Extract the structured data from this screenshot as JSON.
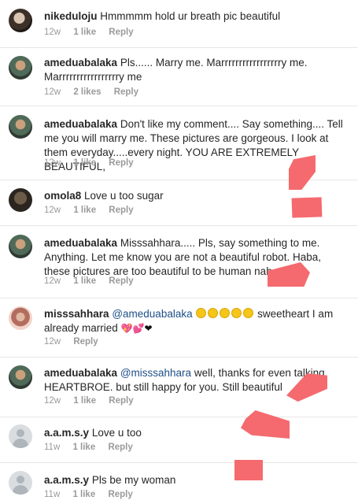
{
  "comments": [
    {
      "username": "nikeduloju",
      "text": "Hmmmmm hold ur breath pic beautiful",
      "time": "12w",
      "likes": "1 like",
      "reply": "Reply"
    },
    {
      "username": "ameduabalaka",
      "text": "Pls...... Marry me. Marrrrrrrrrrrrrrrrry me. Marrrrrrrrrrrrrrrrry me",
      "time": "12w",
      "likes": "2 likes",
      "reply": "Reply"
    },
    {
      "username": "ameduabalaka",
      "text": "Don't like my comment.... Say something.... Tell me you will marry me. These pictures are gorgeous. I look at them everyday.....every night. YOU ARE EXTREMELY BEAUTIFUL,",
      "time": "12w",
      "likes": "1 like",
      "reply": "Reply"
    },
    {
      "username": "omola8",
      "text": "Love u too sugar",
      "time": "12w",
      "likes": "1 like",
      "reply": "Reply"
    },
    {
      "username": "ameduabalaka",
      "text": "Misssahhara..... Pls, say something to me. Anything. Let me know you are not a beautiful robot. Haba, these pictures are too beautiful to be human nah.",
      "time": "12w",
      "likes": "1 like",
      "reply": "Reply"
    },
    {
      "username": "misssahhara",
      "mention": "@ameduabalaka",
      "text": "sweetheart I am already married",
      "time": "12w",
      "reply": "Reply"
    },
    {
      "username": "ameduabalaka",
      "mention": "@misssahhara",
      "text": "well, thanks for even talking. HEARTBROE. but still happy for you. Still beautiful",
      "time": "12w",
      "likes": "1 like",
      "reply": "Reply"
    },
    {
      "username": "a.a.m.s.y",
      "text": "Love u too",
      "time": "11w",
      "likes": "1 like",
      "reply": "Reply"
    },
    {
      "username": "a.a.m.s.y",
      "text": "Pls be my woman",
      "time": "11w",
      "likes": "1 like",
      "reply": "Reply"
    }
  ],
  "colors": {
    "redaction": "#f46a6e",
    "username": "#262626",
    "mention": "#1d4f87",
    "meta": "#9a9a9a"
  }
}
